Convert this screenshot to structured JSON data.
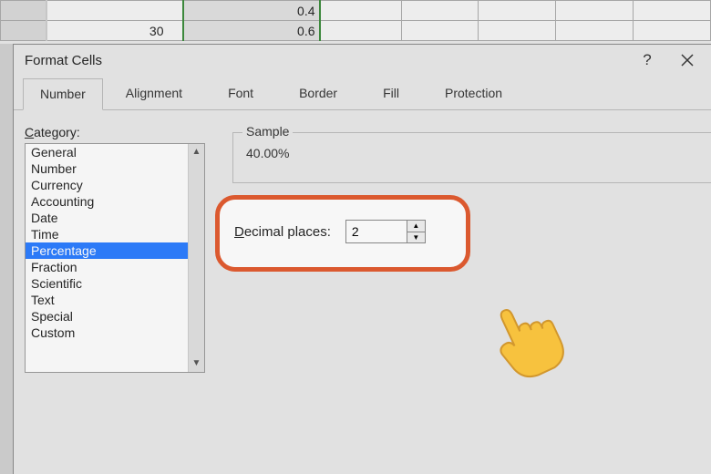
{
  "sheet": {
    "rows": [
      {
        "hdr": "",
        "val": "0.4"
      },
      {
        "hdr": "30",
        "val": "0.6"
      }
    ]
  },
  "dialog": {
    "title": "Format Cells",
    "help": "?",
    "tabs": [
      {
        "label": "Number",
        "active": true
      },
      {
        "label": "Alignment",
        "active": false
      },
      {
        "label": "Font",
        "active": false
      },
      {
        "label": "Border",
        "active": false
      },
      {
        "label": "Fill",
        "active": false
      },
      {
        "label": "Protection",
        "active": false
      }
    ],
    "number_tab": {
      "category_label_pre": "C",
      "category_label_rest": "ategory:",
      "categories": [
        "General",
        "Number",
        "Currency",
        "Accounting",
        "Date",
        "Time",
        "Percentage",
        "Fraction",
        "Scientific",
        "Text",
        "Special",
        "Custom"
      ],
      "selected_category_index": 6,
      "sample_label": "Sample",
      "sample_value": "40.00%",
      "decimal_label_pre": "D",
      "decimal_label_rest": "ecimal places:",
      "decimal_value": "2"
    }
  }
}
